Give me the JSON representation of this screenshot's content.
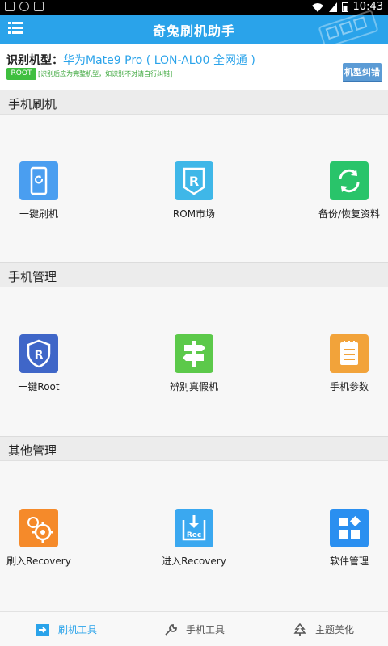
{
  "status_bar": {
    "time": "10:43"
  },
  "app": {
    "title": "奇兔刷机助手"
  },
  "device": {
    "label": "识别机型：",
    "model": "华为Mate9 Pro ( LON-AL00 全网通 )",
    "root_badge": "ROOT",
    "note": "[识别后应为完整机型，如识别不对请自行纠错]",
    "fix_button": "机型纠错"
  },
  "sections": [
    {
      "title": "手机刷机",
      "items": [
        {
          "label": "一键刷机",
          "icon": "phone-refresh-icon",
          "color": "#4a9ef0"
        },
        {
          "label": "ROM市场",
          "icon": "rom-market-icon",
          "color": "#3fb7e8"
        },
        {
          "label": "备份/恢复资料",
          "icon": "backup-sync-icon",
          "color": "#29c46a"
        }
      ]
    },
    {
      "title": "手机管理",
      "items": [
        {
          "label": "一键Root",
          "icon": "root-shield-icon",
          "color": "#3f66c8"
        },
        {
          "label": "辨别真假机",
          "icon": "signpost-icon",
          "color": "#5cc94a"
        },
        {
          "label": "手机参数",
          "icon": "notepad-icon",
          "color": "#f2a33a"
        }
      ]
    },
    {
      "title": "其他管理",
      "items": [
        {
          "label": "刷入Recovery",
          "icon": "gear-flash-icon",
          "color": "#f58a2a"
        },
        {
          "label": "进入Recovery",
          "icon": "rec-download-icon",
          "color": "#3aa8f0"
        },
        {
          "label": "软件管理",
          "icon": "apps-grid-icon",
          "color": "#2a8ff0"
        }
      ]
    }
  ],
  "bottom_nav": [
    {
      "label": "刷机工具",
      "icon": "flash-tool-icon",
      "active": true
    },
    {
      "label": "手机工具",
      "icon": "wrench-icon",
      "active": false
    },
    {
      "label": "主题美化",
      "icon": "tree-icon",
      "active": false
    }
  ],
  "colors": {
    "accent": "#2aa3ea",
    "badge_green": "#3fbf3f"
  }
}
